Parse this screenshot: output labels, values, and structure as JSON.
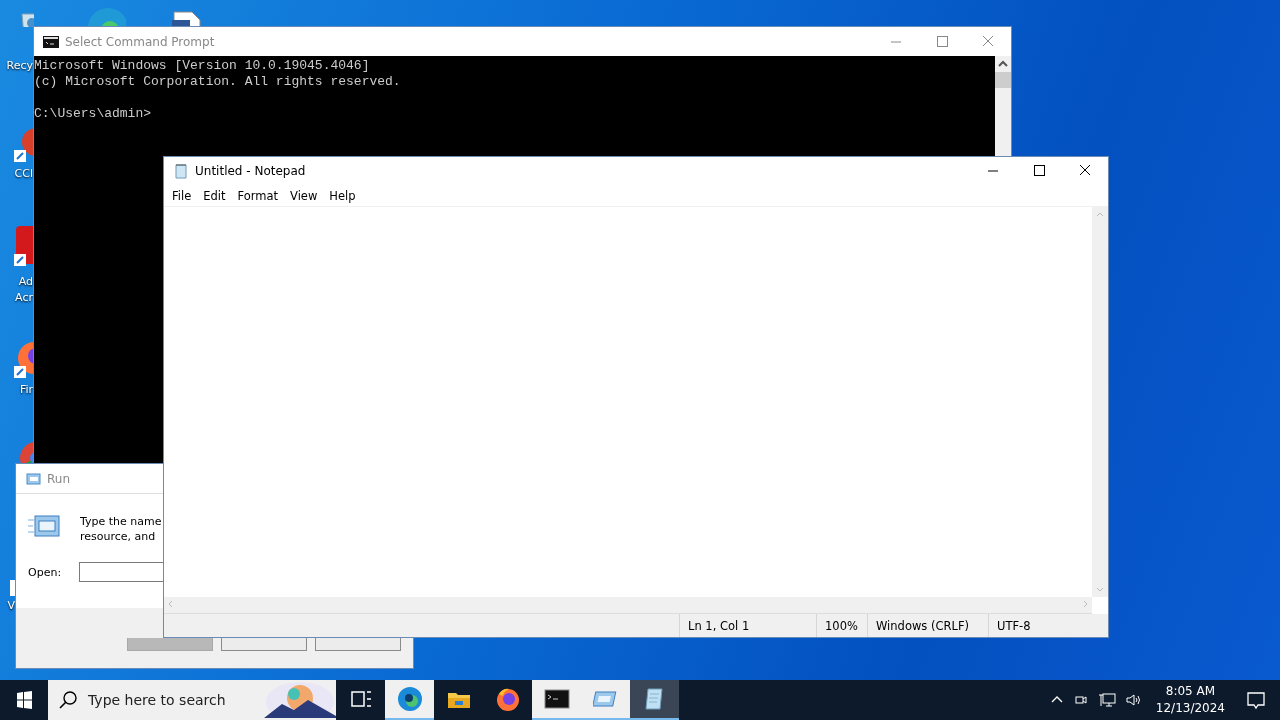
{
  "desktop_icons": [
    {
      "kind": "recycle",
      "lines": [
        "Recy"
      ]
    },
    {
      "kind": "edge"
    },
    {
      "kind": "document"
    },
    {
      "kind": "ccleaner",
      "lines": [
        "CCl"
      ]
    },
    {
      "kind": "acrobat",
      "lines": [
        "Ad",
        "Acr"
      ]
    },
    {
      "kind": "firefox",
      "lines": [
        "Fir"
      ]
    },
    {
      "kind": "chrome"
    },
    {
      "kind": "generic",
      "lines": [
        "V"
      ]
    }
  ],
  "cmd": {
    "title": "Select Command Prompt",
    "lines": [
      "Microsoft Windows [Version 10.0.19045.4046]",
      "(c) Microsoft Corporation. All rights reserved."
    ],
    "prompt": "C:\\Users\\admin>"
  },
  "run": {
    "title": "Run",
    "description": [
      "Type the name",
      "resource, and"
    ],
    "open_label": "Open:",
    "buttons": [
      {
        "disabled": true
      },
      {
        "disabled": false
      },
      {
        "disabled": false
      }
    ]
  },
  "notepad": {
    "title": "Untitled - Notepad",
    "menu": [
      "File",
      "Edit",
      "Format",
      "View",
      "Help"
    ],
    "status": [
      "Ln 1, Col 1",
      "100%",
      "Windows (CRLF)",
      "UTF-8"
    ]
  },
  "taskbar": {
    "search_placeholder": "Type here to search",
    "apps": [
      {
        "kind": "taskview",
        "running": false,
        "selected": false
      },
      {
        "kind": "edge",
        "running": true,
        "selected": false
      },
      {
        "kind": "explorer",
        "running": false,
        "selected": false
      },
      {
        "kind": "firefox",
        "running": false,
        "selected": false
      },
      {
        "kind": "cmd",
        "running": true,
        "selected": false
      },
      {
        "kind": "run",
        "running": true,
        "selected": false
      },
      {
        "kind": "notepad",
        "running": true,
        "selected": true
      }
    ],
    "time": "8:05 AM",
    "date": "12/13/2024"
  }
}
